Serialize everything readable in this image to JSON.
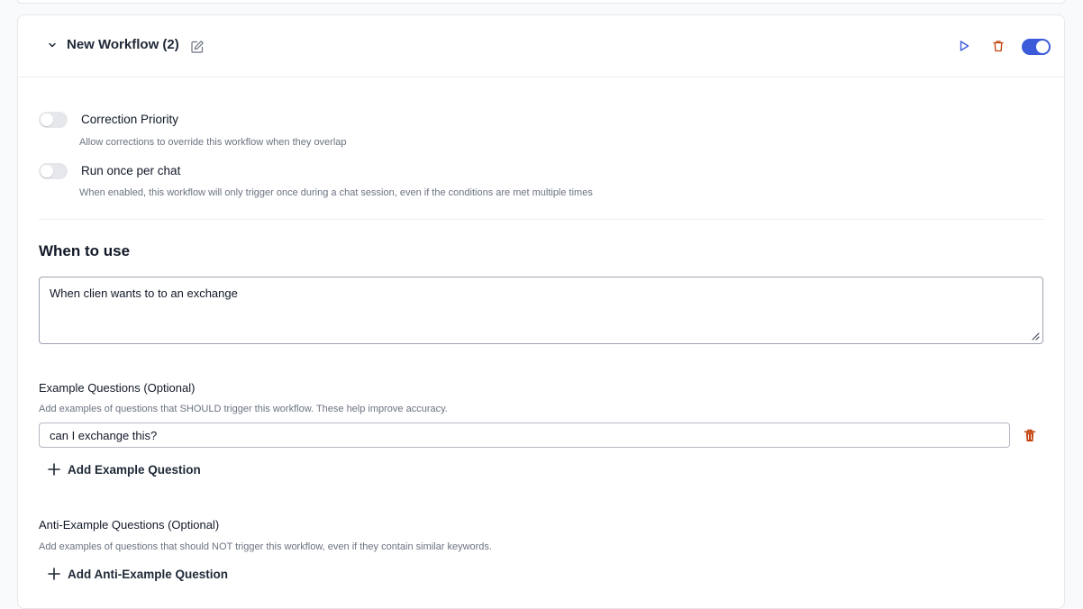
{
  "workflow": {
    "title": "New Workflow (2)",
    "enabled": true,
    "icons": {
      "collapse": "chevron-down-icon",
      "edit": "edit-icon",
      "run": "play-icon",
      "delete": "trash-icon",
      "toggle": "toggle-switch"
    }
  },
  "options": [
    {
      "label": "Correction Priority",
      "description": "Allow corrections to override this workflow when they overlap",
      "enabled": false
    },
    {
      "label": "Run once per chat",
      "description": "When enabled, this workflow will only trigger once during a chat session, even if the conditions are met multiple times",
      "enabled": false
    }
  ],
  "when_to_use": {
    "title": "When to use",
    "value": "When clien wants to to an exchange"
  },
  "example_questions": {
    "label": "Example Questions (Optional)",
    "description": "Add examples of questions that SHOULD trigger this workflow. These help improve accuracy.",
    "items": [
      "can I exchange this?"
    ],
    "add_label": "Add Example Question"
  },
  "anti_example_questions": {
    "label": "Anti-Example Questions (Optional)",
    "description": "Add examples of questions that should NOT trigger this workflow, even if they contain similar keywords.",
    "add_label": "Add Anti-Example Question"
  },
  "colors": {
    "accent": "#3b5bdb",
    "danger": "#c2410c",
    "toggle_off": "#e5e7eb"
  }
}
